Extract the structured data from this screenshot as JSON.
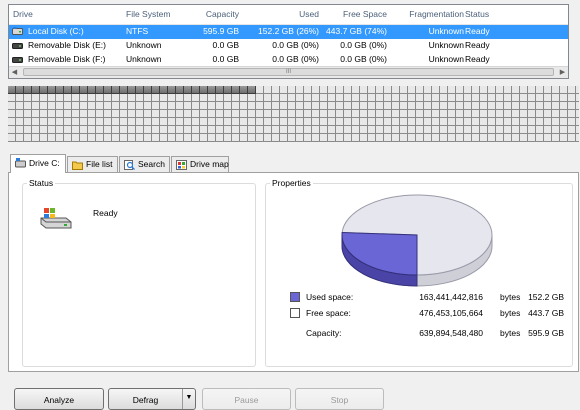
{
  "drive_list": {
    "columns": [
      "Drive",
      "File System",
      "Capacity",
      "Used",
      "Free Space",
      "Fragmentation",
      "Status"
    ],
    "rows": [
      {
        "drive": "Local Disk (C:)",
        "fs": "NTFS",
        "capacity": "595.9 GB",
        "used": "152.2 GB (26%)",
        "free": "443.7 GB (74%)",
        "frag": "Unknown",
        "status": "Ready",
        "icon": "hard-disk-icon",
        "selected": true
      },
      {
        "drive": "Removable Disk (E:)",
        "fs": "Unknown",
        "capacity": "0.0 GB",
        "used": "0.0 GB (0%)",
        "free": "0.0 GB (0%)",
        "frag": "Unknown",
        "status": "Ready",
        "icon": "removable-disk-icon",
        "selected": false
      },
      {
        "drive": "Removable Disk (F:)",
        "fs": "Unknown",
        "capacity": "0.0 GB",
        "used": "0.0 GB (0%)",
        "free": "0.0 GB (0%)",
        "frag": "Unknown",
        "status": "Ready",
        "icon": "removable-disk-icon",
        "selected": false
      }
    ],
    "scrollbar_grip": "III"
  },
  "tabs": [
    {
      "label": "Drive C:",
      "icon": "drive-icon",
      "active": true
    },
    {
      "label": "File list",
      "icon": "folder-icon",
      "active": false
    },
    {
      "label": "Search",
      "icon": "search-icon",
      "active": false
    },
    {
      "label": "Drive map",
      "icon": "drive-map-icon",
      "active": false
    }
  ],
  "status_group": {
    "title": "Status",
    "text": "Ready",
    "icon": "windows-drive-icon"
  },
  "properties_group": {
    "title": "Properties",
    "used": {
      "label": "Used space:",
      "bytes": "163,441,442,816",
      "unit": "bytes",
      "size": "152.2 GB",
      "color": "#6b66d6"
    },
    "free": {
      "label": "Free space:",
      "bytes": "476,453,105,664",
      "unit": "bytes",
      "size": "443.7 GB",
      "color": "#ffffff"
    },
    "capacity": {
      "label": "Capacity:",
      "bytes": "639,894,548,480",
      "unit": "bytes",
      "size": "595.9 GB"
    }
  },
  "chart_data": {
    "type": "pie",
    "categories": [
      "Used space",
      "Free space"
    ],
    "values": [
      26,
      74
    ],
    "colors": [
      "#6b66d6",
      "#e6e6ee"
    ]
  },
  "buttons": {
    "analyze": "Analyze",
    "defrag": "Defrag",
    "pause": "Pause",
    "stop": "Stop"
  },
  "colors": {
    "selection": "#3399ff",
    "used": "#6b66d6"
  }
}
